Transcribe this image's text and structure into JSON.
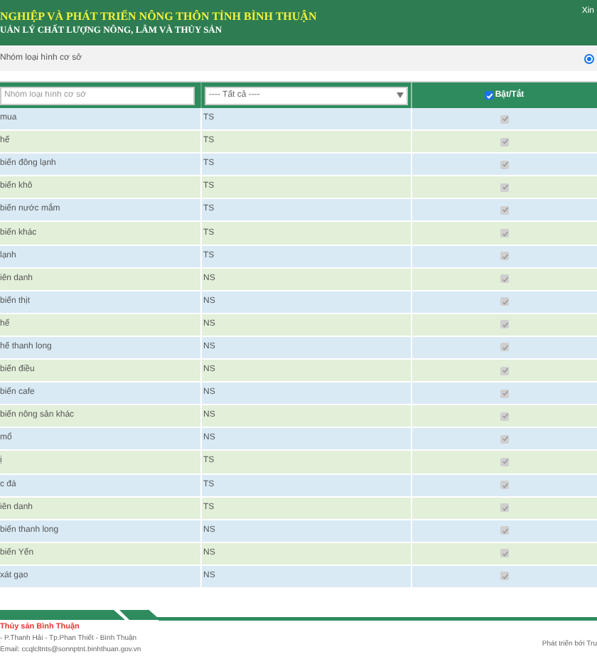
{
  "header": {
    "title": "NGHIỆP VÀ PHÁT TRIỂN NÔNG THÔN TỈNH BÌNH THUẬN",
    "subtitle": "UẢN LÝ CHẤT LƯỢNG NÔNG, LÂM VÀ THỦY SẢN",
    "greeting": "Xin"
  },
  "group_option": {
    "label": "Nhóm loại hình cơ sở",
    "selected": true
  },
  "filters": {
    "search_placeholder": "Nhóm loại hình cơ sở",
    "select_value": "---- Tất cả ----",
    "toggle_label": "Bật/Tắt",
    "toggle_checked": true
  },
  "rows": [
    {
      "name": "mua",
      "group": "TS",
      "checked": true
    },
    {
      "name": "hế",
      "group": "TS",
      "checked": true
    },
    {
      "name": "biến đông lạnh",
      "group": "TS",
      "checked": true
    },
    {
      "name": "biến khô",
      "group": "TS",
      "checked": true
    },
    {
      "name": "biến nước mắm",
      "group": "TS",
      "checked": true
    },
    {
      "name": "biến khác",
      "group": "TS",
      "checked": true
    },
    {
      "name": "lạnh",
      "group": "TS",
      "checked": true
    },
    {
      "name": "iên danh",
      "group": "NS",
      "checked": true
    },
    {
      "name": "biến thịt",
      "group": "NS",
      "checked": true
    },
    {
      "name": "hế",
      "group": "NS",
      "checked": true
    },
    {
      "name": "hế thanh long",
      "group": "NS",
      "checked": true
    },
    {
      "name": "biến điều",
      "group": "NS",
      "checked": true
    },
    {
      "name": "biến cafe",
      "group": "NS",
      "checked": true
    },
    {
      "name": "biến nông sản khác",
      "group": "NS",
      "checked": true
    },
    {
      "name": "mổ",
      "group": "NS",
      "checked": true
    },
    {
      "name": "ị",
      "group": "TS",
      "checked": true
    },
    {
      "name": "c đá",
      "group": "TS",
      "checked": true
    },
    {
      "name": "iên danh",
      "group": "TS",
      "checked": true
    },
    {
      "name": "biến thanh long",
      "group": "NS",
      "checked": true
    },
    {
      "name": "biến Yến",
      "group": "NS",
      "checked": true
    },
    {
      "name": "xát gạo",
      "group": "NS",
      "checked": true
    }
  ],
  "footer": {
    "org": "Thủy sản Bình Thuận",
    "address": "- P.Thanh Hải - Tp.Phan Thiết - Bình Thuận",
    "email": "Email: ccqlcltnts@sonnptnt.binhthuan.gov.vn",
    "credit": "Phát triển bởi Tru"
  }
}
